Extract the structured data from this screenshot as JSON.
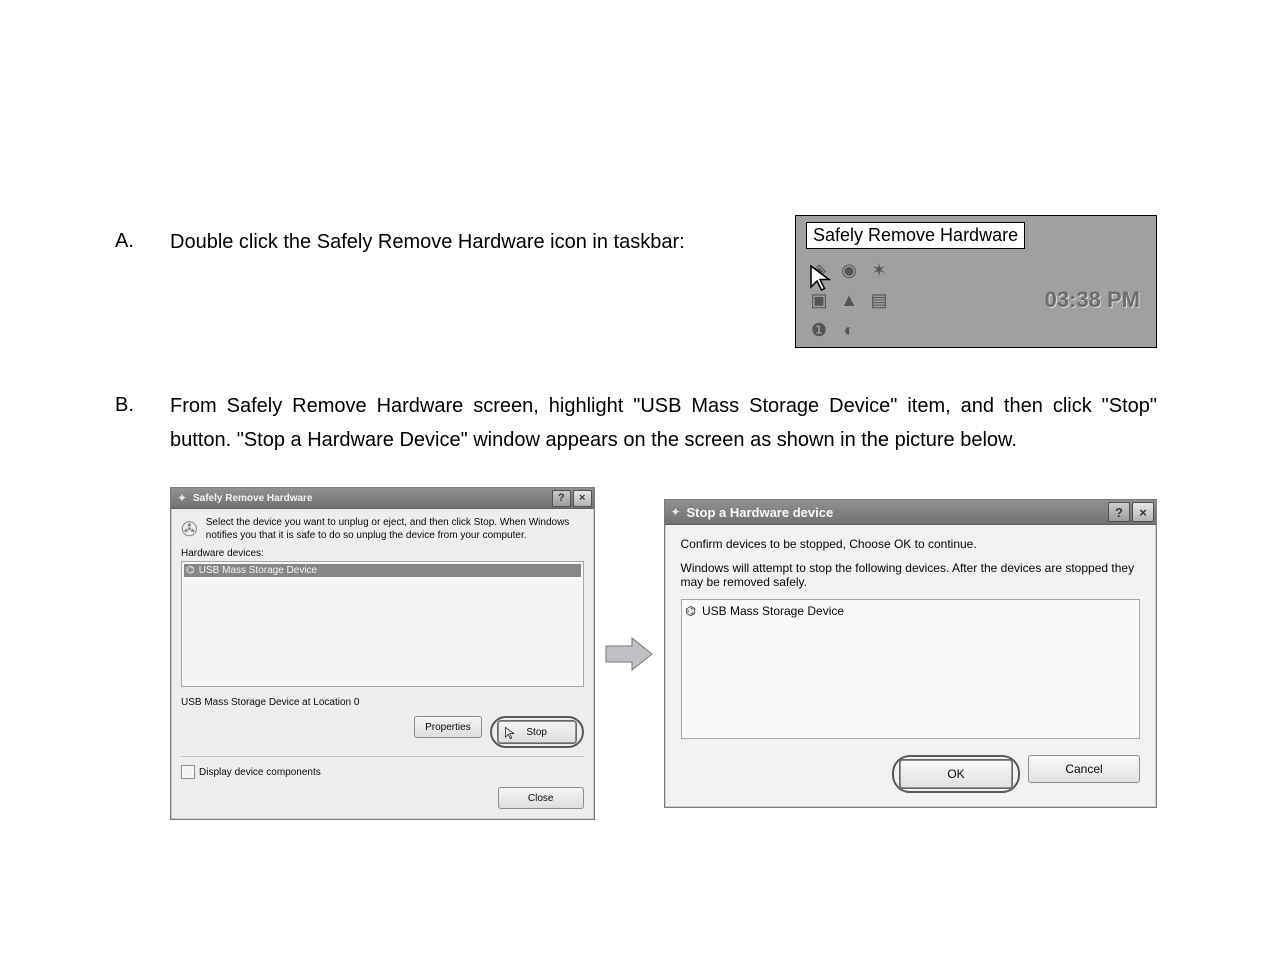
{
  "steps": {
    "A": {
      "label": "A.",
      "text": "Double click the Safely Remove Hardware icon in taskbar:"
    },
    "B": {
      "label": "B.",
      "text": "From Safely Remove Hardware screen, highlight \"USB Mass Storage Device\" item, and then click \"Stop\" button. \"Stop a Hardware Device\" window appears on the screen as shown in the picture below."
    }
  },
  "taskbar": {
    "tooltip": "Safely Remove Hardware",
    "time": "03:38 PM"
  },
  "dialog_left": {
    "title": "Safely Remove Hardware",
    "intro": "Select the device you want to unplug or eject, and then click Stop. When Windows notifies you that it is safe to do so unplug the device from your computer.",
    "list_label": "Hardware devices:",
    "device_selected": "USB Mass Storage Device",
    "status_text": "USB Mass Storage Device at Location 0",
    "btn_properties": "Properties",
    "btn_stop": "Stop",
    "chk_label": "Display device components",
    "btn_close": "Close",
    "help_glyph": "?",
    "close_glyph": "×"
  },
  "dialog_right": {
    "title": "Stop a Hardware device",
    "line1": "Confirm devices to be stopped, Choose OK to continue.",
    "line2": "Windows will attempt to stop the following devices. After the devices are stopped they may be removed safely.",
    "device": "USB Mass Storage Device",
    "btn_ok": "OK",
    "btn_cancel": "Cancel",
    "help_glyph": "?",
    "close_glyph": "×"
  }
}
